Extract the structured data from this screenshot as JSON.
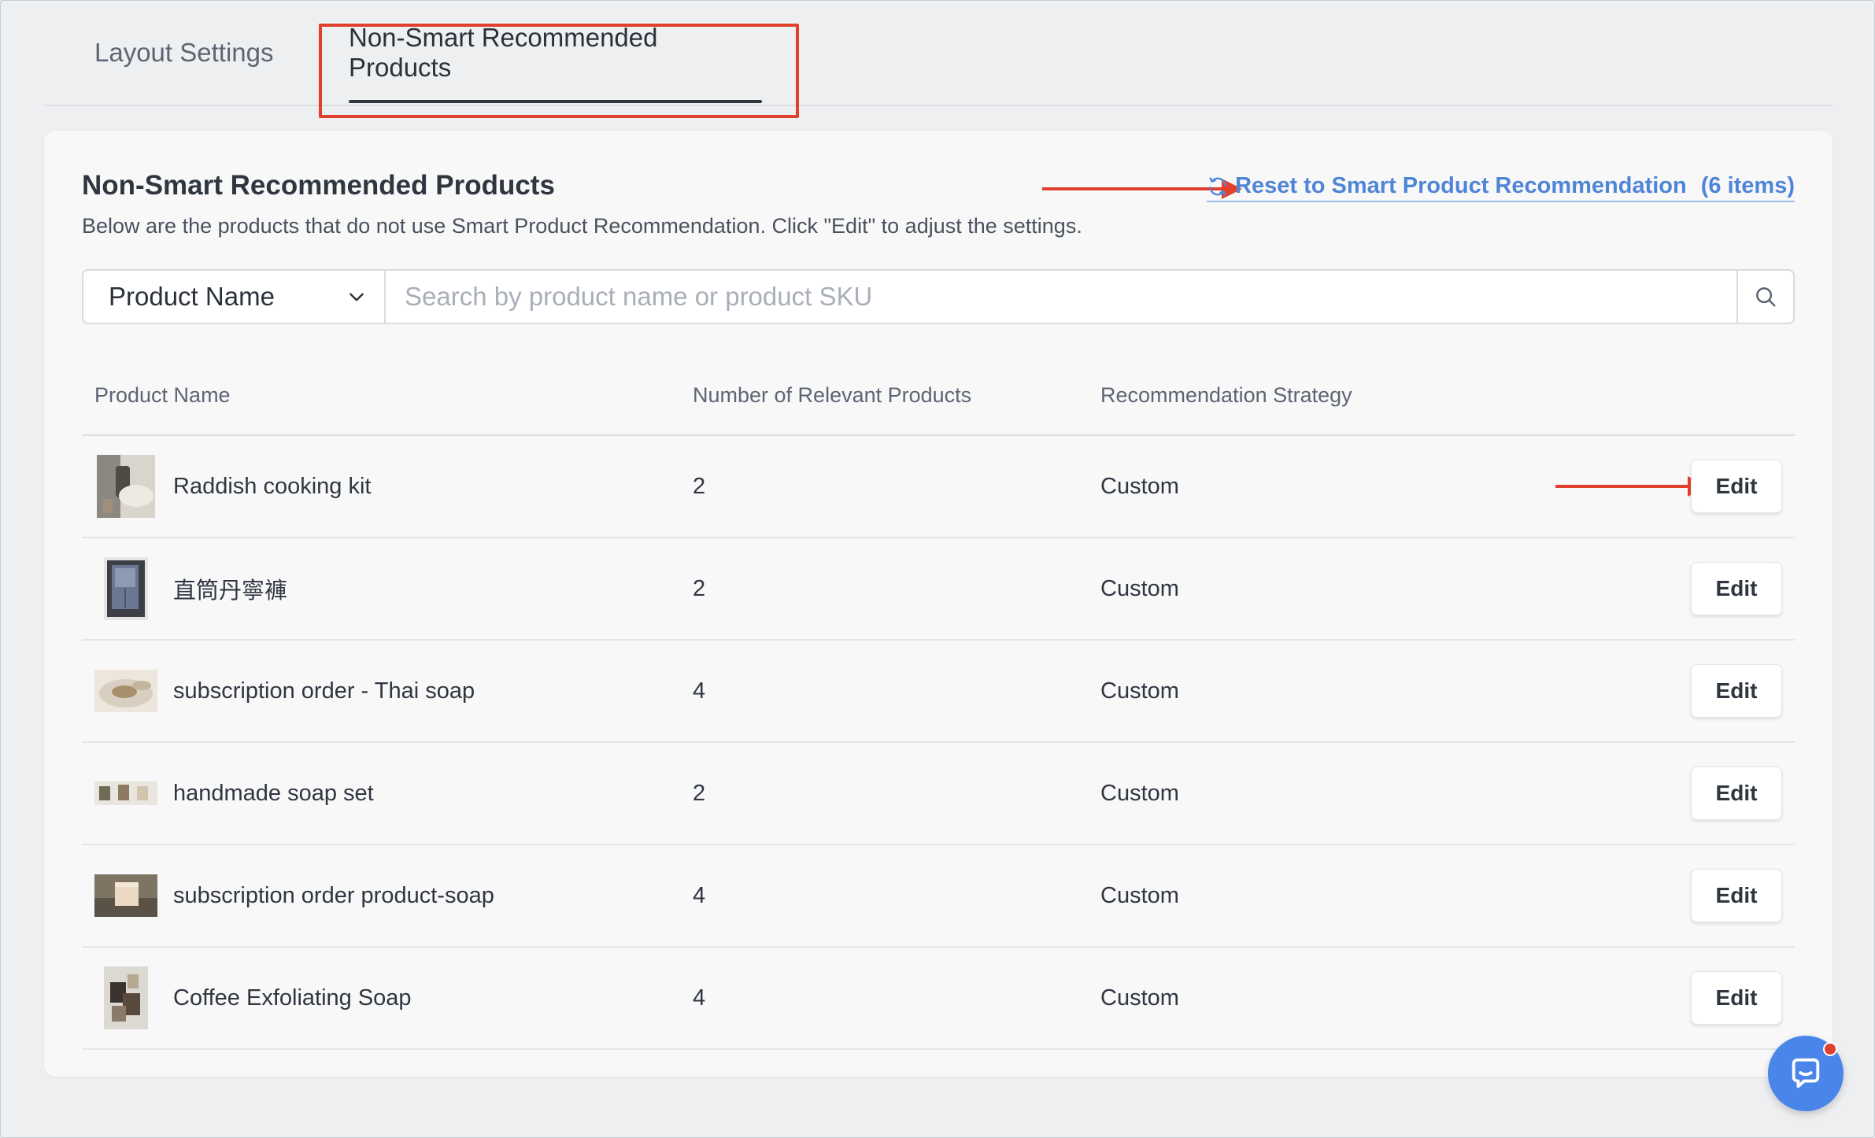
{
  "tabs": [
    {
      "label": "Layout Settings",
      "active": false
    },
    {
      "label": "Non-Smart Recommended Products",
      "active": true
    }
  ],
  "panel": {
    "title": "Non-Smart Recommended Products",
    "description": "Below are the products that do not use Smart Product Recommendation. Click \"Edit\" to adjust the settings.",
    "reset_link": {
      "icon": "refresh-icon",
      "label": "Reset to Smart Product Recommendation",
      "count": "(6 items)"
    }
  },
  "search": {
    "field_selected": "Product Name",
    "placeholder": "Search by product name or product SKU",
    "value": ""
  },
  "table": {
    "headers": {
      "name": "Product Name",
      "count": "Number of Relevant Products",
      "strategy": "Recommendation Strategy"
    },
    "rows": [
      {
        "name": "Raddish cooking kit",
        "count": "2",
        "strategy": "Custom",
        "action": "Edit"
      },
      {
        "name": "直筒丹寧褲",
        "count": "2",
        "strategy": "Custom",
        "action": "Edit"
      },
      {
        "name": "subscription order - Thai soap",
        "count": "4",
        "strategy": "Custom",
        "action": "Edit"
      },
      {
        "name": "handmade soap set",
        "count": "2",
        "strategy": "Custom",
        "action": "Edit"
      },
      {
        "name": "subscription order product-soap",
        "count": "4",
        "strategy": "Custom",
        "action": "Edit"
      },
      {
        "name": "Coffee Exfoliating Soap",
        "count": "4",
        "strategy": "Custom",
        "action": "Edit"
      }
    ]
  },
  "colors": {
    "accent_link": "#4f85d6",
    "annotation_red": "#e0402c",
    "chat_button": "#4a86ea"
  }
}
